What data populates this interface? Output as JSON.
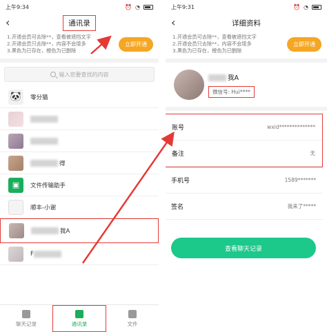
{
  "left_screen": {
    "status_time": "上午9:34",
    "title": "通讯录",
    "promo_lines": [
      "1.开通会员可去除**，查看被遮挡文字",
      "2.开通会员只去除**，内容不会增多",
      "3.黑色为已存在，橙色为已删除"
    ],
    "promo_button": "立即开通",
    "search_placeholder": "输入您要查找的内容",
    "contacts": [
      {
        "name": "零分猫",
        "avatar": "panda-icon"
      },
      {
        "name": "",
        "avatar": "blurred-photo"
      },
      {
        "name": "",
        "avatar": "blurred-photo"
      },
      {
        "name": "得",
        "avatar": "blurred-photo"
      },
      {
        "name": "文件传输助手",
        "avatar": "file-transfer-icon"
      },
      {
        "name": "顺丰-小谢",
        "avatar": "white-icon"
      },
      {
        "name": "我A",
        "avatar": "blurred-photo"
      },
      {
        "name": "F",
        "avatar": "blurred-photo"
      }
    ],
    "tabs": [
      "聊天记录",
      "通讯录",
      "文件"
    ]
  },
  "right_screen": {
    "status_time": "上午9:31",
    "title": "详细资料",
    "promo_lines": [
      "1.开通会员可去除**，查看被遮挡文字",
      "2.开通会员只去除**，内容不会增多",
      "3.黑色为已存在，橙色为已删除"
    ],
    "promo_button": "立即开通",
    "profile_name": "我A",
    "wechat_id": "微信号: Hui****",
    "rows": [
      {
        "key": "账号",
        "value": "wxid**************"
      },
      {
        "key": "备注",
        "value": "无"
      },
      {
        "key": "手机号",
        "value": "1589*******"
      },
      {
        "key": "签名",
        "value": "我来了*****"
      }
    ],
    "chat_button": "查看聊天记录"
  },
  "colors": {
    "accent_green": "#1aad5b",
    "button_green": "#1cc88a",
    "promo_orange": "#f5a623",
    "annotation_red": "#e53935"
  }
}
